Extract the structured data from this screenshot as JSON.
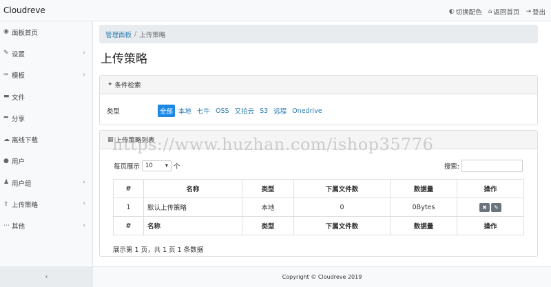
{
  "app": {
    "brand": "Cloudreve"
  },
  "topnav": [
    {
      "icon": "toggle-icon",
      "label": "切换配色"
    },
    {
      "icon": "home-icon",
      "label": "返回首页"
    },
    {
      "icon": "logout-icon",
      "label": "登出"
    }
  ],
  "sidebar": {
    "items": [
      {
        "label": "面板首页",
        "icon": "dashboard-icon",
        "chevron": false
      },
      {
        "label": "设置",
        "icon": "wrench-icon",
        "chevron": true
      },
      {
        "label": "模板",
        "icon": "brush-icon",
        "chevron": true
      },
      {
        "label": "文件",
        "icon": "folder-icon",
        "chevron": false
      },
      {
        "label": "分享",
        "icon": "share-icon",
        "chevron": false
      },
      {
        "label": "离线下载",
        "icon": "cloud-download-icon",
        "chevron": false
      },
      {
        "label": "用户",
        "icon": "user-icon",
        "chevron": false
      },
      {
        "label": "用户组",
        "icon": "users-icon",
        "chevron": true
      },
      {
        "label": "上传策略",
        "icon": "upload-icon",
        "chevron": true
      },
      {
        "label": "其他",
        "icon": "more-icon",
        "chevron": true
      }
    ],
    "collapse_label": "‹"
  },
  "breadcrumb": {
    "home": "管理面板",
    "separator": "/",
    "current": "上传策略"
  },
  "page_title": "上传策略",
  "filter": {
    "header": "条件检索",
    "label": "类型",
    "options": [
      "全部",
      "本地",
      "七牛",
      "OSS",
      "又拍云",
      "S3",
      "远程",
      "Onedrive"
    ],
    "active_index": 0
  },
  "list": {
    "header": "上传策略列表",
    "length_prefix": "每页展示",
    "length_value": "10",
    "length_suffix": "个",
    "search_label": "搜索:",
    "search_value": "",
    "columns": [
      "#",
      "名称",
      "类型",
      "下属文件数",
      "数据量",
      "操作"
    ],
    "rows": [
      {
        "id": "1",
        "name": "默认上传策略",
        "type": "本地",
        "files": "0",
        "size": "0Bytes"
      }
    ],
    "info": "展示第 1 页，共 1 页 1 条数据"
  },
  "footer": {
    "text": "Copyright © Cloudreve 2019"
  },
  "watermark": "https://www.huzhan.com/ishop35776",
  "colors": {
    "accent": "#1e88e5",
    "link": "#2a7ab0",
    "action_button": "#6c757d"
  }
}
